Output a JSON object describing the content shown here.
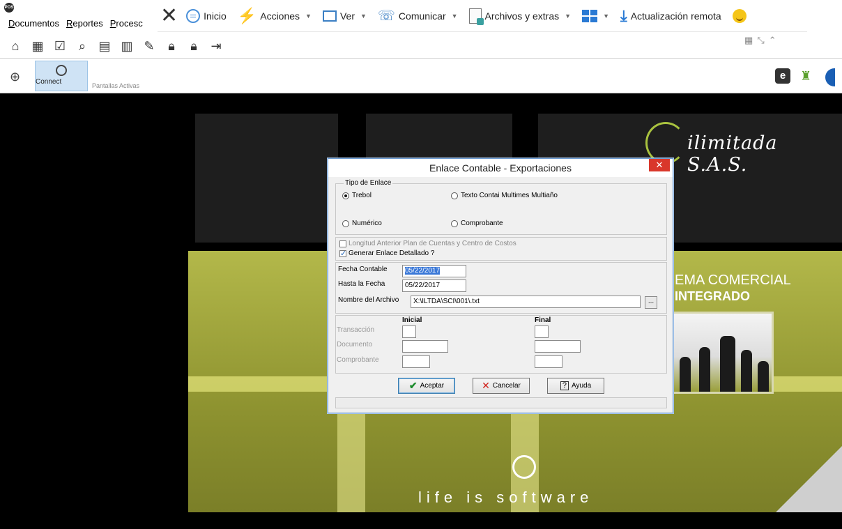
{
  "menubar": {
    "logo_text": "POS",
    "items": [
      "Documentos",
      "Reportes",
      "Procesc"
    ]
  },
  "remote_toolbar": {
    "inicio": "Inicio",
    "acciones": "Acciones",
    "ver": "Ver",
    "comunicar": "Comunicar",
    "archivos": "Archivos y extras",
    "actualizacion": "Actualización remota",
    "caret": "▼"
  },
  "connectbar": {
    "connect_label": "Connect",
    "pantallas": "Pantallas Activas",
    "e_icon_text": "e"
  },
  "background": {
    "brand": "ilimitada S.A.S.",
    "sistema_line1": "EMA COMERCIAL",
    "sistema_line2": "INTEGRADO",
    "slogan": "life is software"
  },
  "dialog": {
    "title": "Enlace Contable - Exportaciones",
    "close": "✕",
    "tipo_enlace_legend": "Tipo de Enlace",
    "radio_trebol": "Trebol",
    "radio_texto": "Texto Contai Multimes Multiaño",
    "radio_numerico": "Numérico",
    "radio_comprobante": "Comprobante",
    "chk_longitud": "Longitud Anterior Plan de Cuentas y Centro de Costos",
    "chk_generar": "Generar Enlace Detallado ?",
    "fecha_contable_label": "Fecha Contable",
    "fecha_contable_value": "05/22/2017",
    "hasta_label": "Hasta la Fecha",
    "hasta_value": "05/22/2017",
    "archivo_label": "Nombre del Archivo",
    "archivo_value": "X:\\ILTDA\\SCI\\001\\.txt",
    "browse": "...",
    "inicial": "Inicial",
    "final": "Final",
    "transaccion": "Transacción",
    "documento": "Documento",
    "comprobante": "Comprobante",
    "aceptar": "Aceptar",
    "cancelar": "Cancelar",
    "ayuda": "Ayuda"
  }
}
